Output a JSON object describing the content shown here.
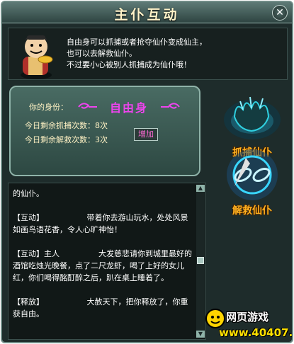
{
  "window": {
    "title": "主仆互动",
    "close_icon": "close-icon"
  },
  "intro": {
    "lines": [
      "自由身可以抓捕或者抢夺仙仆变成仙主，",
      "也可以去解救仙仆。",
      "不过要小心被别人抓捕成为仙仆哦！"
    ]
  },
  "identity": {
    "label": "你的身份：",
    "value": "自由身",
    "capture_label": "今日剩余抓捕次数：",
    "capture_count": "8次",
    "rescue_label": "今日剩余解救次数：",
    "rescue_count": "3次",
    "add_button": "增加"
  },
  "actions": {
    "capture": {
      "label": "抓捕仙仆",
      "icon": "claw-hand-icon"
    },
    "rescue": {
      "label": "解救仙仆",
      "icon": "broken-chain-icon"
    }
  },
  "log": {
    "entries": [
      "的仙仆。",
      "【互动】　　　　　　带着你去游山玩水，处处风景如画鸟语花香，令人心旷神怡！",
      "【互动】主人　　　　　大发慈悲请你到城里最好的酒馆吃烛光晚餐，点了二尺龙虾，喝了上好的女儿红，你们喝得酩酊醉之后，趴在桌上睡着了。",
      "【释放】　　　　　　大赦天下，把你释放了，你重获自由。"
    ]
  },
  "watermark": {
    "title": "网页游戏",
    "site": "www.40407.com"
  },
  "colors": {
    "identity_value": "#ee44ee",
    "action_label": "#ffb020",
    "panel_bg": "#1e2c2b"
  }
}
